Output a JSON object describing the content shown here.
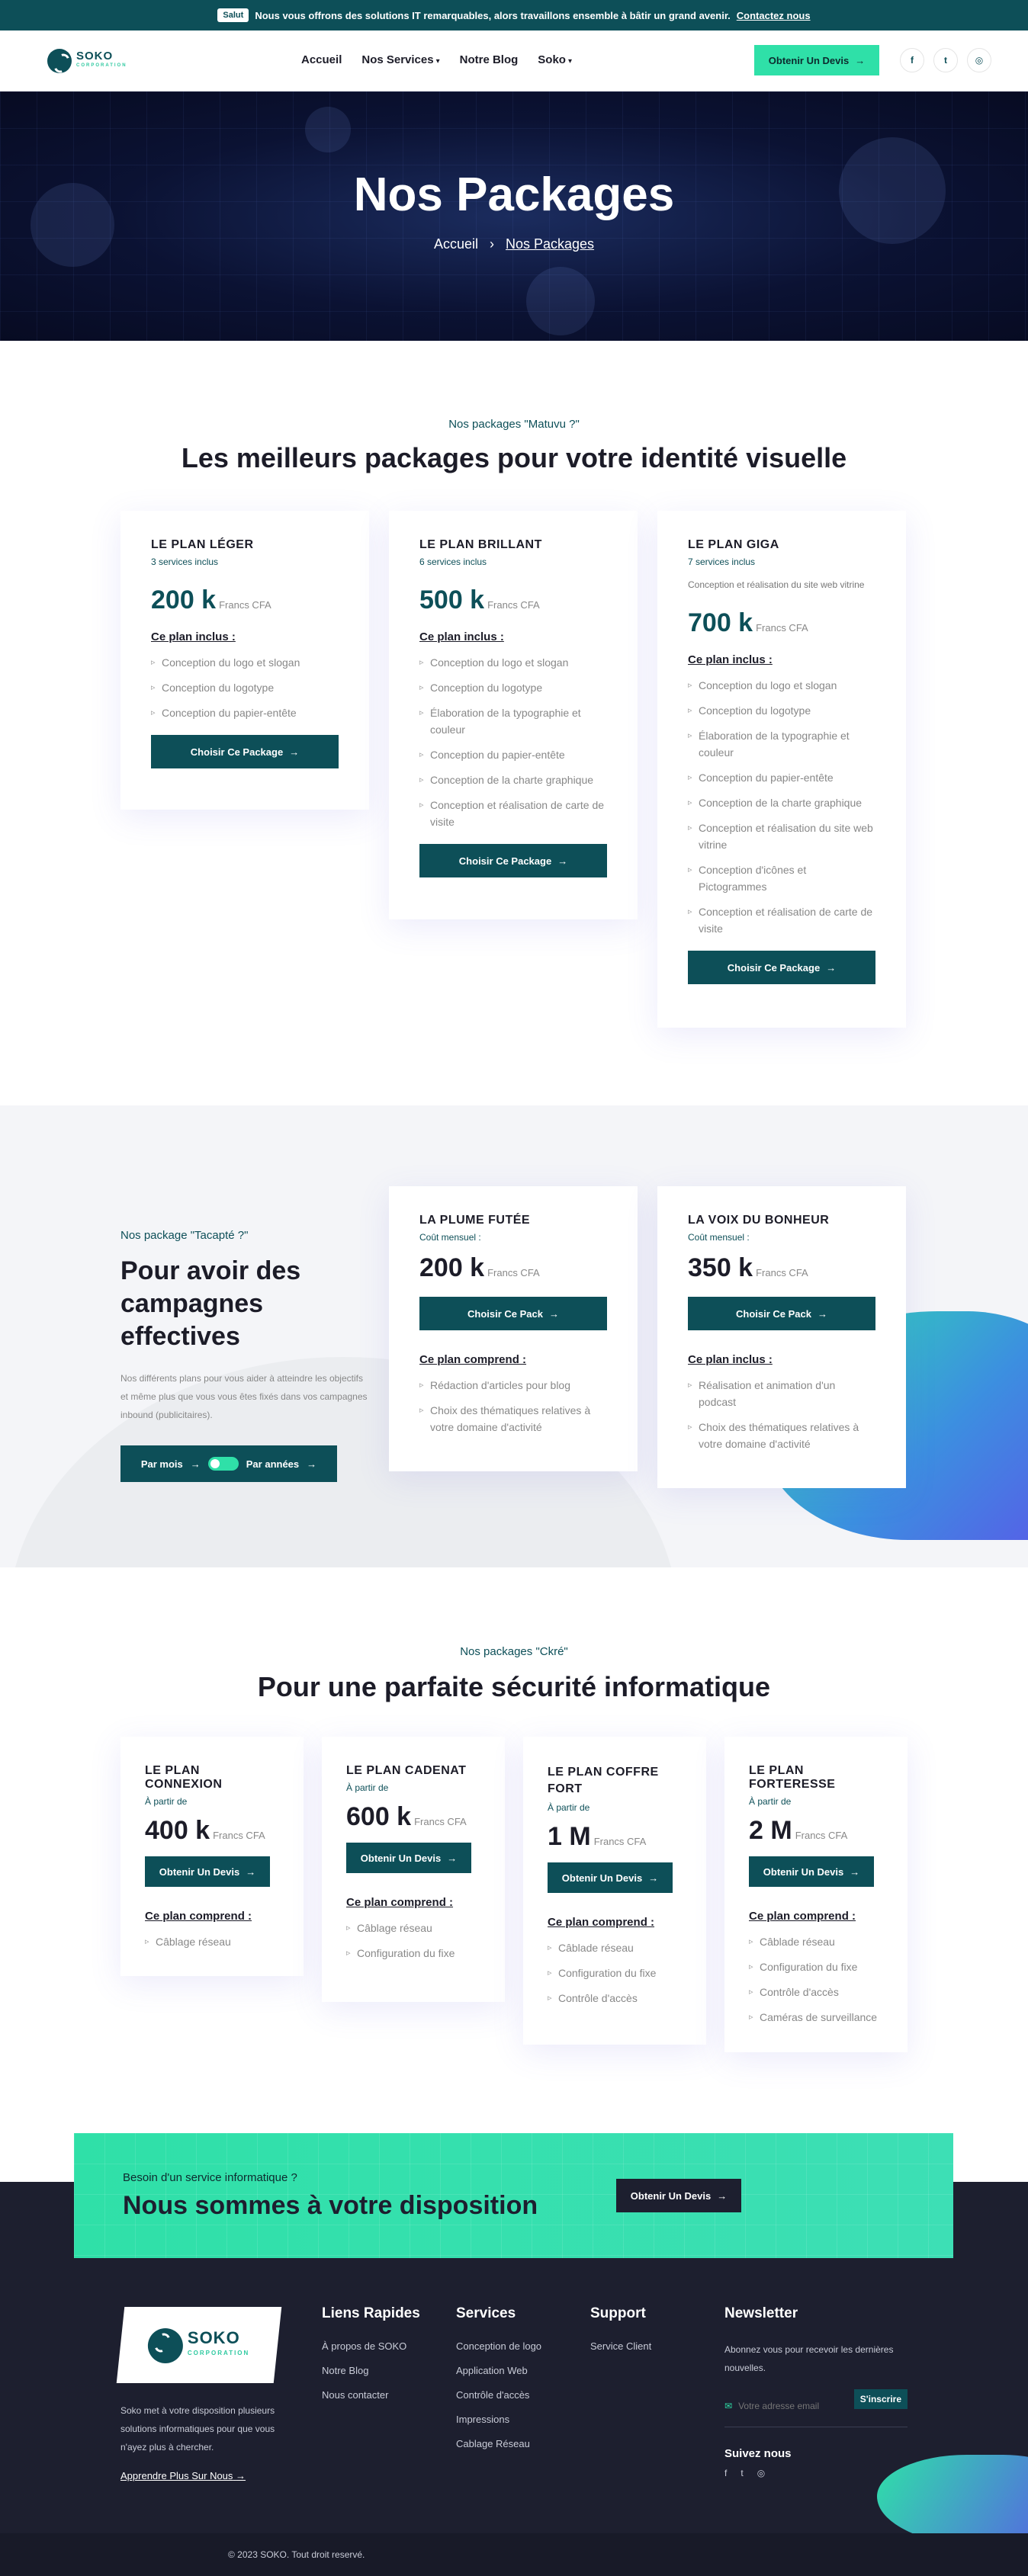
{
  "topbar": {
    "pill": "Salut",
    "message": "Nous vous offrons des solutions IT remarquables, alors travaillons ensemble à bâtir un grand avenir.",
    "link": "Contactez nous"
  },
  "header": {
    "logo": "SOKO",
    "logo_tag": "CORPORATION",
    "nav": [
      {
        "label": "Accueil"
      },
      {
        "label": "Nos Services",
        "caret": true
      },
      {
        "label": "Notre Blog"
      },
      {
        "label": "Soko",
        "caret": true
      }
    ],
    "cta": "Obtenir Un Devis",
    "social": [
      "facebook-icon",
      "twitter-icon",
      "instagram-icon"
    ]
  },
  "hero": {
    "title": "Nos Packages",
    "crumb_home": "Accueil",
    "crumb_current": "Nos Packages"
  },
  "matuvu": {
    "eyebrow": "Nos packages \"Matuvu ?\"",
    "title": "Les meilleurs packages pour votre identité visuelle",
    "included_label": "Ce plan inclus :",
    "button": "Choisir Ce Package",
    "plans": [
      {
        "name": "LE PLAN LÉGER",
        "sub": "3 services inclus",
        "price": "200 k",
        "unit": "Francs CFA",
        "items": [
          "Conception du logo et slogan",
          "Conception du logotype",
          "Conception du papier-entête"
        ]
      },
      {
        "name": "LE PLAN BRILLANT",
        "sub": "6 services inclus",
        "price": "500 k",
        "unit": "Francs CFA",
        "items": [
          "Conception du logo et slogan",
          "Conception du logotype",
          "Élaboration de la typographie et couleur",
          "Conception du papier-entête",
          "Conception de la charte graphique",
          "Conception et réalisation de carte de visite"
        ]
      },
      {
        "name": "LE PLAN GIGA",
        "sub": "7 services inclus",
        "desc": "Conception et réalisation du site web vitrine",
        "price": "700 k",
        "unit": "Francs CFA",
        "items": [
          "Conception du logo et slogan",
          "Conception du logotype",
          "Élaboration de la typographie et couleur",
          "Conception du papier-entête",
          "Conception de la charte graphique",
          "Conception et réalisation du site web vitrine",
          "Conception d'icônes et Pictogrammes",
          "Conception et réalisation de carte de visite"
        ]
      }
    ]
  },
  "tacapte": {
    "eyebrow": "Nos package \"Tacapté ?\"",
    "title": "Pour avoir des campagnes effectives",
    "text": "Nos différents plans pour vous aider à atteindre les objectifs et même plus que vous vous êtes fixés dans vos campagnes inbound (publicitaires).",
    "toggle_left": "Par mois",
    "toggle_right": "Par années",
    "button": "Choisir Ce Pack",
    "plans": [
      {
        "name": "LA PLUME FUTÉE",
        "sub": "Coût mensuel :",
        "price": "200 k",
        "unit": "Francs CFA",
        "label": "Ce plan comprend :",
        "items": [
          "Rédaction d'articles pour blog",
          "Choix des thématiques relatives à votre domaine d'activité"
        ]
      },
      {
        "name": "LA VOIX DU BONHEUR",
        "sub": "Coût mensuel :",
        "price": "350 k",
        "unit": "Francs CFA",
        "label": "Ce plan inclus :",
        "items": [
          "Réalisation et animation d'un podcast",
          "Choix des thématiques relatives à votre domaine d'activité"
        ]
      }
    ]
  },
  "kre": {
    "eyebrow": "Nos packages \"Ckré\"",
    "title": "Pour une parfaite sécurité informatique",
    "label": "Ce plan comprend :",
    "button": "Obtenir Un Devis",
    "plans": [
      {
        "name": "LE PLAN CONNEXION",
        "sub": "À partir de",
        "price": "400 k",
        "unit": "Francs CFA",
        "items": [
          "Câblage réseau"
        ]
      },
      {
        "name": "LE PLAN CADENAT",
        "sub": "À partir de",
        "price": "600 k",
        "unit": "Francs CFA",
        "items": [
          "Câblage réseau",
          "Configuration du fixe"
        ]
      },
      {
        "name": "LE PLAN COFFRE FORT",
        "sub": "À partir de",
        "price": "1 M",
        "unit": "Francs CFA",
        "items": [
          "Câblade réseau",
          "Configuration du fixe",
          "Contrôle d'accès"
        ]
      },
      {
        "name": "LE PLAN FORTERESSE",
        "sub": "À partir de",
        "price": "2 M",
        "unit": "Francs CFA",
        "items": [
          "Câblade réseau",
          "Configuration du fixe",
          "Contrôle d'accès",
          "Caméras de surveillance"
        ]
      }
    ]
  },
  "cta": {
    "eyebrow": "Besoin d'un service informatique ?",
    "title": "Nous sommes à votre disposition",
    "button": "Obtenir Un Devis"
  },
  "footer": {
    "about": "Soko met à votre disposition plusieurs solutions informatiques pour que vous n'ayez plus à chercher.",
    "about_link": "Apprendre Plus Sur Nous",
    "cols": [
      {
        "title": "Liens Rapides",
        "links": [
          "À propos de SOKO",
          "Notre Blog",
          "Nous contacter"
        ]
      },
      {
        "title": "Services",
        "links": [
          "Conception de logo",
          "Application Web",
          "Contrôle d'accès",
          "Impressions",
          "Cablage Réseau"
        ]
      },
      {
        "title": "Support",
        "links": [
          "Service Client"
        ]
      }
    ],
    "newsletter": {
      "title": "Newsletter",
      "text": "Abonnez vous pour recevoir les dernières nouvelles.",
      "placeholder": "Votre adresse email",
      "button": "S'inscrire",
      "follow": "Suivez nous"
    },
    "copyright": "© 2023 SOKO. Tout droit reservé."
  }
}
